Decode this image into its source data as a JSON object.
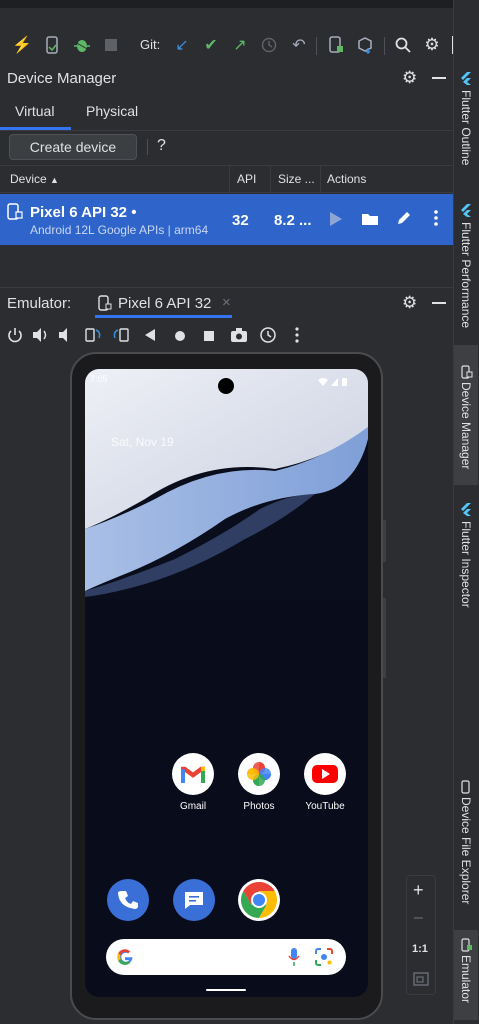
{
  "toolbar": {
    "git_label": "Git:",
    "icons": [
      "lightning-icon",
      "apply-changes-icon",
      "debug-bug-icon",
      "stop-icon",
      "git-update-icon",
      "git-commit-icon",
      "git-push-icon",
      "history-icon",
      "rollback-icon",
      "device-mirror-icon",
      "sdk-icon",
      "search-icon",
      "settings-icon",
      "avatar-icon"
    ]
  },
  "device_manager": {
    "title": "Device Manager",
    "tabs": [
      {
        "label": "Virtual",
        "active": true
      },
      {
        "label": "Physical",
        "active": false
      }
    ],
    "create_device_label": "Create device",
    "help_label": "?",
    "columns": {
      "device": "Device",
      "api": "API",
      "size": "Size ...",
      "actions": "Actions"
    },
    "devices": [
      {
        "name": "Pixel 6 API 32",
        "status_dot": "•",
        "subtitle": "Android 12L Google APIs | arm64",
        "api": "32",
        "size": "8.2 ..."
      }
    ]
  },
  "emulator": {
    "label": "Emulator:",
    "tab_label": "Pixel 6 API 32",
    "tab_close": "×",
    "zoom_in": "+",
    "zoom_out": "–",
    "zoom_reset": "1:1"
  },
  "phone": {
    "time": "7:05",
    "date": "Sat, Nov 19",
    "apps": [
      {
        "label": "Gmail"
      },
      {
        "label": "Photos"
      },
      {
        "label": "YouTube"
      }
    ]
  },
  "right_sidebar": {
    "items": [
      "Flutter Outline",
      "Flutter Performance",
      "Device Manager",
      "Flutter Inspector",
      "Device File Explorer",
      "Emulator"
    ]
  },
  "colors": {
    "accent": "#3574f0",
    "selected_row": "#2f65ca",
    "background": "#2b2d30"
  }
}
